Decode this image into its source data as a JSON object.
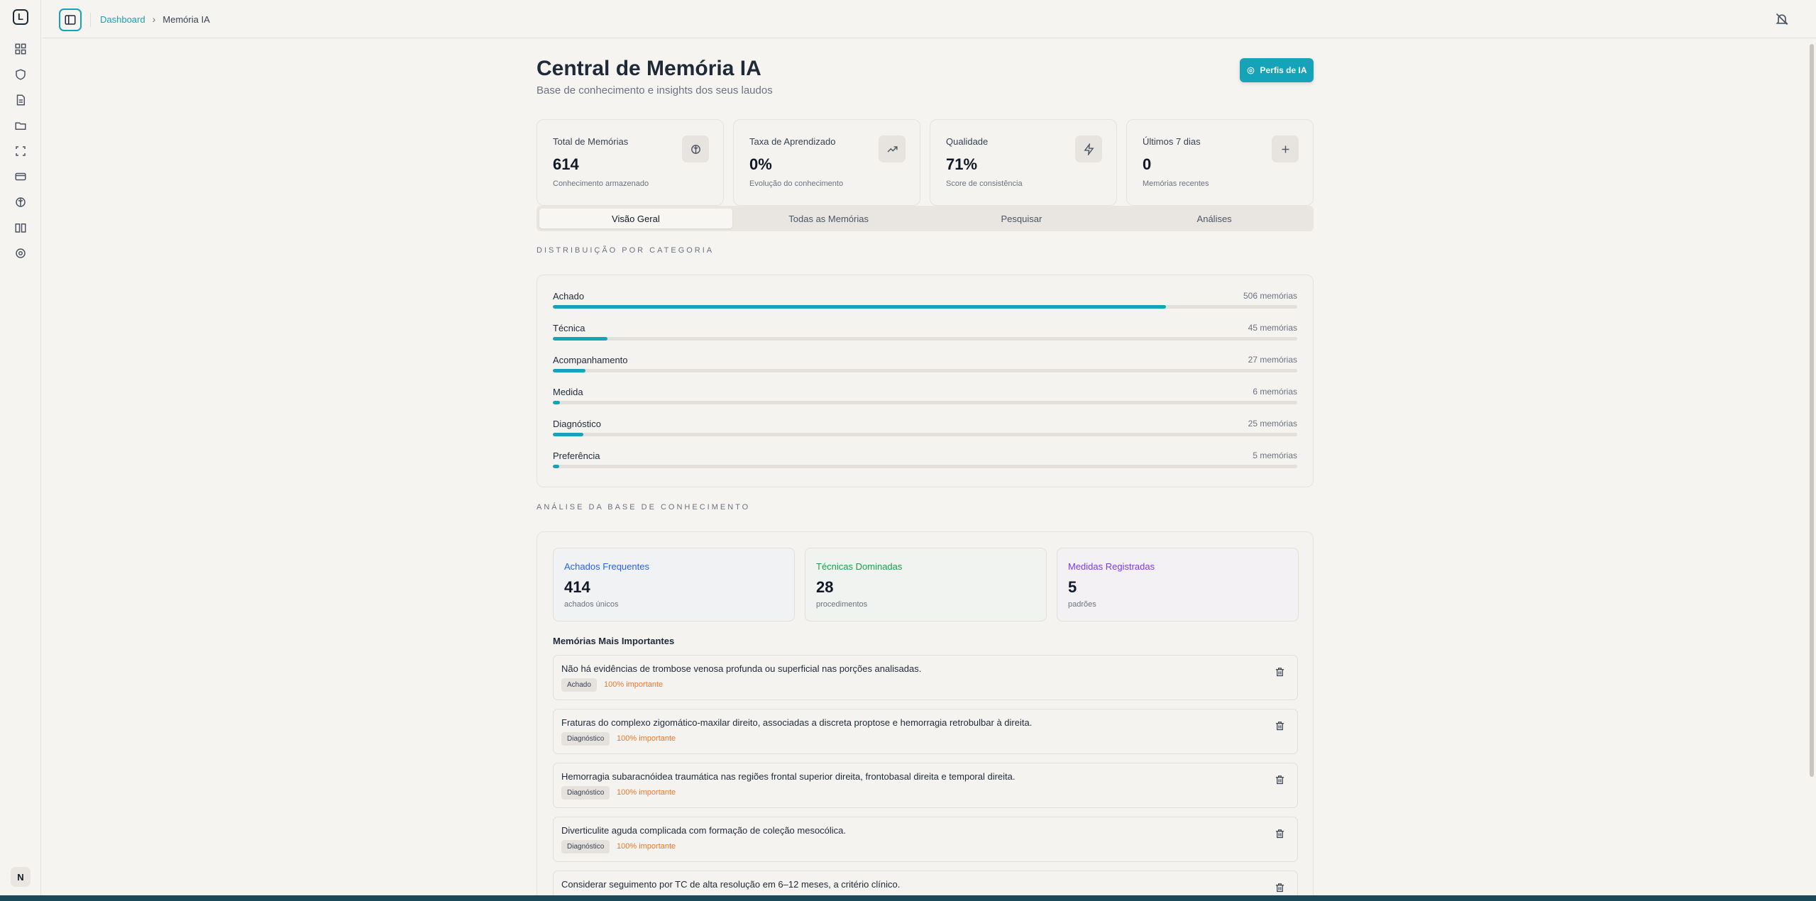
{
  "colors": {
    "accent": "#14a3b8",
    "importance": "#ea7a2a",
    "blue": "#2563eb",
    "green": "#16a34a",
    "purple": "#7c3aed"
  },
  "rail": {
    "logo": "L",
    "icons": [
      "grid-icon",
      "shield-icon",
      "document-icon",
      "folder-icon",
      "scan-icon",
      "card-icon",
      "brain-icon",
      "book-icon",
      "gear-icon"
    ],
    "avatar": "N"
  },
  "breadcrumb": {
    "parent": "Dashboard",
    "separator": "›",
    "current": "Memória IA"
  },
  "header": {
    "title": "Central de Memória IA",
    "subtitle": "Base de conhecimento e insights dos seus laudos",
    "profiles_button": "Perfis de IA"
  },
  "stats": [
    {
      "label": "Total de Memórias",
      "value": "614",
      "desc": "Conhecimento armazenado",
      "icon": "brain-icon"
    },
    {
      "label": "Taxa de Aprendizado",
      "value": "0%",
      "desc": "Evolução do conhecimento",
      "icon": "trending-up-icon"
    },
    {
      "label": "Qualidade",
      "value": "71%",
      "desc": "Score de consistência",
      "icon": "zap-icon"
    },
    {
      "label": "Últimos 7 dias",
      "value": "0",
      "desc": "Memórias recentes",
      "icon": "plus-icon"
    }
  ],
  "tabs": [
    "Visão Geral",
    "Todas as Memórias",
    "Pesquisar",
    "Análises"
  ],
  "active_tab": 0,
  "distribution": {
    "label": "Distribuição por Categoria",
    "max": 614,
    "categories": [
      {
        "name": "Achado",
        "count": 506,
        "count_label": "506 memórias"
      },
      {
        "name": "Técnica",
        "count": 45,
        "count_label": "45 memórias"
      },
      {
        "name": "Acompanhamento",
        "count": 27,
        "count_label": "27 memórias"
      },
      {
        "name": "Medida",
        "count": 6,
        "count_label": "6 memórias"
      },
      {
        "name": "Diagnóstico",
        "count": 25,
        "count_label": "25 memórias"
      },
      {
        "name": "Preferência",
        "count": 5,
        "count_label": "5 memórias"
      }
    ]
  },
  "analysis": {
    "label": "Análise da Base de Conhecimento",
    "cards": [
      {
        "title": "Achados Frequentes",
        "value": "414",
        "desc": "achados únicos",
        "color": "#2563eb",
        "bg": "#f1f2f4"
      },
      {
        "title": "Técnicas Dominadas",
        "value": "28",
        "desc": "procedimentos",
        "color": "#16a34a",
        "bg": "#f0f3ef"
      },
      {
        "title": "Medidas Registradas",
        "value": "5",
        "desc": "padrões",
        "color": "#7c3aed",
        "bg": "#f3f1f4"
      }
    ],
    "important_title": "Memórias Mais Importantes",
    "memories": [
      {
        "text": "Não há evidências de trombose venosa profunda ou superficial nas porções analisadas.",
        "tag": "Achado",
        "importance": "100% importante"
      },
      {
        "text": "Fraturas do complexo zigomático-maxilar direito, associadas a discreta proptose e hemorragia retrobulbar à direita.",
        "tag": "Diagnóstico",
        "importance": "100% importante"
      },
      {
        "text": "Hemorragia subaracnóidea traumática nas regiões frontal superior direita, frontobasal direita e temporal direita.",
        "tag": "Diagnóstico",
        "importance": "100% importante"
      },
      {
        "text": "Diverticulite aguda complicada com formação de coleção mesocólica.",
        "tag": "Diagnóstico",
        "importance": "100% importante"
      },
      {
        "text": "Considerar seguimento por TC de alta resolução em 6–12 meses, a critério clínico.",
        "tag": "",
        "importance": ""
      }
    ]
  }
}
